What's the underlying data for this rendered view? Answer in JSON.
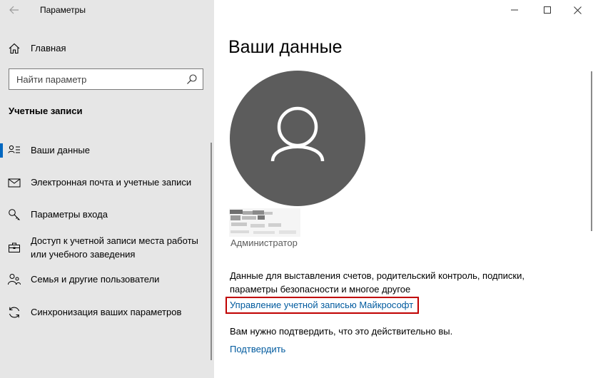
{
  "window": {
    "title": "Параметры",
    "controls": [
      "minimize-icon",
      "maximize-icon",
      "close-icon"
    ]
  },
  "sidebar": {
    "home_label": "Главная",
    "search_placeholder": "Найти параметр",
    "section_title": "Учетные записи",
    "items": [
      {
        "label": "Ваши данные",
        "icon": "person-card-icon",
        "active": true
      },
      {
        "label": "Электронная почта и учетные записи",
        "icon": "mail-icon",
        "active": false
      },
      {
        "label": "Параметры входа",
        "icon": "key-icon",
        "active": false
      },
      {
        "label": "Доступ к учетной записи места работы или учебного заведения",
        "icon": "briefcase-icon",
        "active": false
      },
      {
        "label": "Семья и другие пользователи",
        "icon": "people-icon",
        "active": false
      },
      {
        "label": "Синхронизация ваших параметров",
        "icon": "sync-icon",
        "active": false
      }
    ]
  },
  "main": {
    "title": "Ваши данные",
    "role": "Администратор",
    "info_text": "Данные для выставления счетов, родительский контроль, подписки, параметры безопасности и многое другое",
    "manage_link": "Управление учетной записью Майкрософт",
    "verify_text": "Вам нужно подтвердить, что это действительно вы.",
    "verify_link": "Подтвердить"
  },
  "colors": {
    "sidebar_bg": "#e6e6e6",
    "accent": "#0067c0",
    "link": "#005a9e",
    "avatar_bg": "#5c5c5c",
    "highlight_box": "#c00000"
  }
}
